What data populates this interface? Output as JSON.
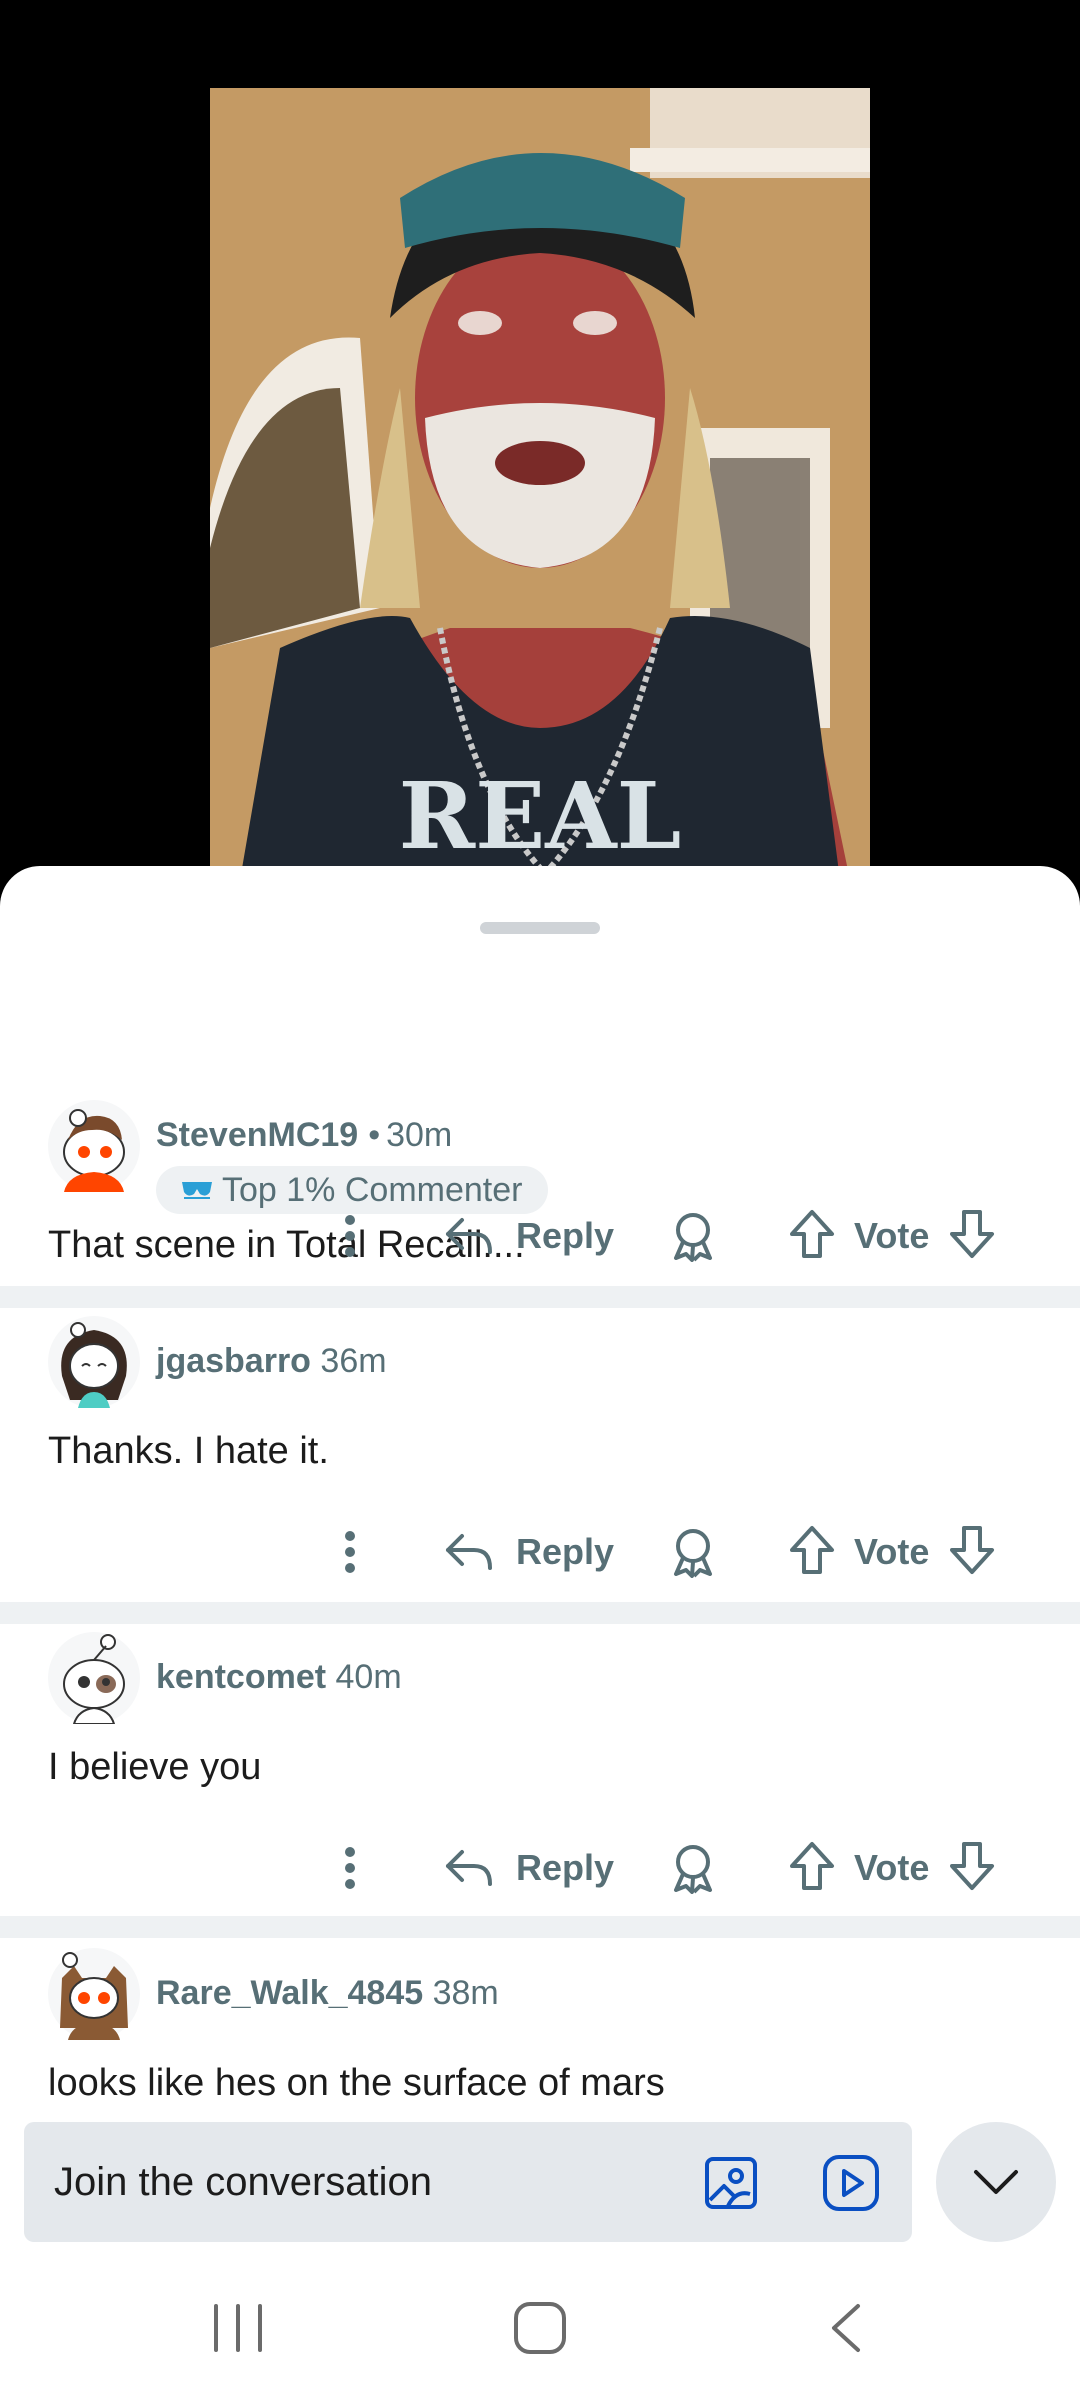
{
  "video": {
    "shirt_text": "REAL"
  },
  "comments": [
    {
      "username": "StevenMC19",
      "separator": "•",
      "time": "30m",
      "badge": "Top 1% Commenter",
      "body": "That scene in Total Recall....",
      "reply_label": "Reply",
      "vote_label": "Vote"
    },
    {
      "username": "jgasbarro",
      "time": "36m",
      "body": "Thanks. I hate it.",
      "reply_label": "Reply",
      "vote_label": "Vote"
    },
    {
      "username": "kentcomet",
      "time": "40m",
      "body": "I believe you",
      "reply_label": "Reply",
      "vote_label": "Vote"
    },
    {
      "username": "Rare_Walk_4845",
      "time": "38m",
      "body": "looks like hes on the surface of mars"
    }
  ],
  "composer": {
    "placeholder": "Join the conversation"
  },
  "icons": {
    "more": "more-vertical-icon",
    "reply": "reply-arrow-icon",
    "award": "award-icon",
    "upvote": "upvote-arrow-icon",
    "downvote": "downvote-arrow-icon",
    "image": "image-icon",
    "video": "video-play-icon",
    "collapse": "chevron-down-icon"
  },
  "colors": {
    "meta_text": "#576f76",
    "divider": "#eef1f3",
    "input_bg": "#e4e8ec",
    "accent_blue": "#0a4fc2"
  }
}
